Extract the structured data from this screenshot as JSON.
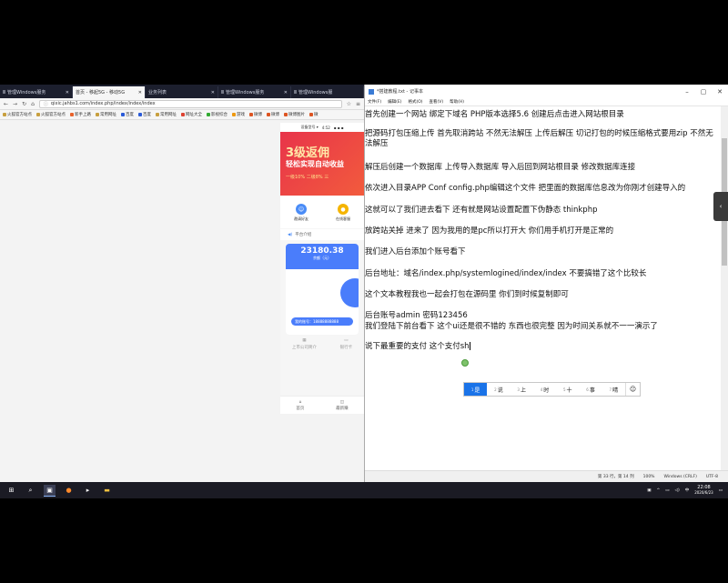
{
  "browser": {
    "tabs": [
      {
        "label": "Ⅲ 管理Windows服务",
        "active": false
      },
      {
        "label": "首页 - 移起5G - 移动5G",
        "active": true
      },
      {
        "label": "业务列表",
        "active": false
      },
      {
        "label": "Ⅲ 管理Windows服务",
        "active": false
      },
      {
        "label": "Ⅲ 管理Windows服",
        "active": false
      }
    ],
    "url": "qixic.jahbs1.com/index.php/index/index/index",
    "bookmarks": [
      "火狐官方站点",
      "火狐官方站点",
      "新手上路",
      "常用网址",
      "百度",
      "百度",
      "常用网址",
      "网址大全",
      "影视综合",
      "游戏",
      "微博",
      "微博",
      "微博图片",
      "微"
    ]
  },
  "phone": {
    "status_left": "设备型号 ▾",
    "status_mid": "4:52",
    "status_right": "▪ ▪ ▪",
    "banner_title": "3级返佣",
    "banner_sub": "轻松实现自动收益",
    "banner_rates": "一级10%  二级8%  三",
    "quick_left": "邀请好友",
    "quick_right": "在线客服",
    "notice": "平台介绍",
    "amount": "23180.38",
    "amount_label": "余额（元）",
    "pill_text": "我的账号：18888888888",
    "menu_left": "上市公司简介",
    "menu_right": "银行卡",
    "nav_home": "首页",
    "nav_more": "最新赚"
  },
  "notepad": {
    "title": "*搭建教程.txt - 记事本",
    "menu": [
      "文件(F)",
      "编辑(E)",
      "格式(O)",
      "查看(V)",
      "帮助(H)"
    ],
    "lines": [
      "首先创建一个网站 绑定下域名 PHP版本选择5.6 创建后点击进入网站根目录",
      "把源码打包压缩上传 首先取消跨站 不然无法解压 上传后解压  切记打包的时候压缩格式要用zip 不然无法解压",
      "解压后创建一个数据库 上传导入数据库 导入后回到网站根目录 修改数据库连接",
      "依次进入目录APP Conf  config.php编辑这个文件 把里面的数据库信息改为你刚才创建导入的",
      "这就可以了我们进去看下  还有就是网站设置配置下伪静态 thinkphp",
      "放跨站关掉  进来了 因为我用的是pc所以打开大 你们用手机打开是正常的",
      "我们进入后台添加个账号看下",
      "后台地址：域名/index.php/systemlogined/index/index 不要搞错了这个比较长",
      "这个文本教程我也一起会打包在源码里 你们到时候复制即可",
      "后台账号admin 密码123456",
      " 我们登陆下前台看下 这个ui还是很不错的 东西也很完整 因为时间关系就不一一演示了",
      "说下最重要的支付 这个支付sh"
    ],
    "status": {
      "pos": "第 33 行，第 14 列",
      "zoom": "100%",
      "eol": "Windows (CRLF)",
      "enc": "UTF-8"
    },
    "ime": {
      "candidates": [
        {
          "n": "1",
          "c": "是"
        },
        {
          "n": "2",
          "c": "说"
        },
        {
          "n": "3",
          "c": "上"
        },
        {
          "n": "4",
          "c": "时"
        },
        {
          "n": "5",
          "c": "十"
        },
        {
          "n": "6",
          "c": "事"
        },
        {
          "n": "7",
          "c": "晴"
        }
      ],
      "emoji": "☺"
    }
  },
  "taskbar": {
    "time": "22:08",
    "date": "2020/6/23",
    "lang": "中",
    "icons": [
      "windows-start",
      "search",
      "task-view",
      "firefox",
      "remote",
      "explorer"
    ]
  }
}
